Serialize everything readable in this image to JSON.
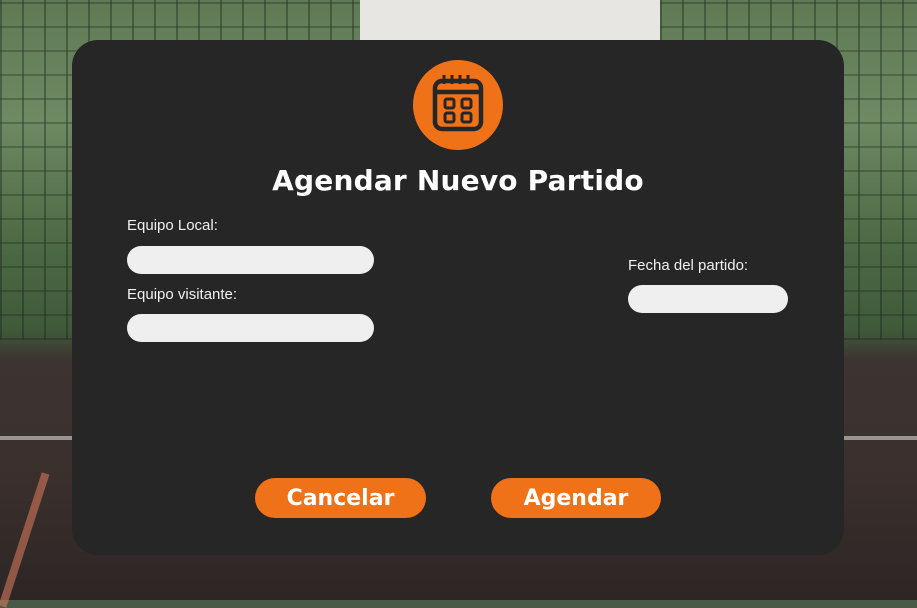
{
  "dialog": {
    "title": "Agendar Nuevo Partido",
    "icon": "calendar-icon",
    "accent_color": "#ef7219",
    "background_color": "#262626"
  },
  "form": {
    "home_team": {
      "label": "Equipo Local:",
      "value": ""
    },
    "away_team": {
      "label": "Equipo visitante:",
      "value": ""
    },
    "match_date": {
      "label": "Fecha del partido:",
      "value": ""
    }
  },
  "actions": {
    "cancel_label": "Cancelar",
    "submit_label": "Agendar"
  }
}
